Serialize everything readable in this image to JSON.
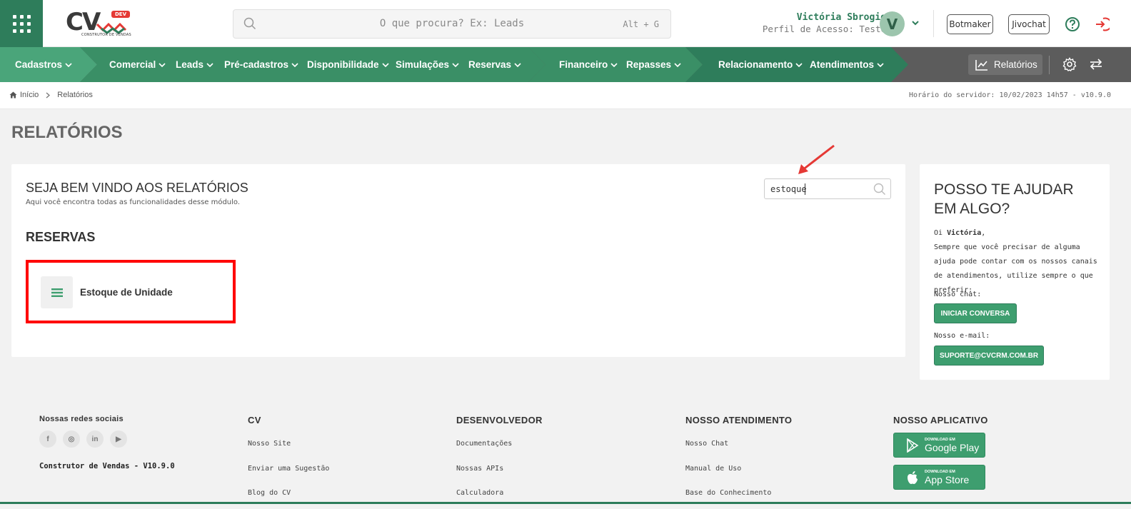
{
  "header": {
    "logo_text": "CV",
    "logo_badge": "DEV",
    "logo_sub": "CONSTRUTOR DE VENDAS",
    "search_placeholder": "O que procura? Ex: Leads",
    "search_shortcut": "Alt + G",
    "user_name": "Victória Sbrogio",
    "user_role": "Perfil de Acesso: Teste",
    "avatar_letter": "V",
    "buttons": [
      "Botmaker",
      "Jivochat"
    ]
  },
  "nav": {
    "items": [
      "Cadastros",
      "Comercial",
      "Leads",
      "Pré-cadastros",
      "Disponibilidade",
      "Simulações",
      "Reservas",
      "Financeiro",
      "Repasses",
      "Relacionamento",
      "Atendimentos"
    ],
    "reports_label": "Relatórios",
    "colors": {
      "dark_green": "#2e7d5b",
      "mid_green": "#3a8f66",
      "light_green": "#4aa57a",
      "gray": "#5c5c5c"
    }
  },
  "breadcrumb": {
    "home": "Início",
    "current": "Relatórios",
    "server_time": "Horário do servidor: 10/02/2023 14h57 - v10.9.0"
  },
  "page": {
    "title": "RELATÓRIOS",
    "welcome_title": "SEJA BEM VINDO AOS RELATÓRIOS",
    "welcome_sub": "Aqui você encontra todas as funcionalidades desse módulo.",
    "search_value": "estoque",
    "section_title": "RESERVAS",
    "report_item": "Estoque de Unidade"
  },
  "help": {
    "title": "POSSO TE AJUDAR EM ALGO?",
    "greeting_prefix": "Oi ",
    "greeting_name": "Victória",
    "greeting_suffix": ",",
    "body": "Sempre que você precisar de alguma ajuda pode contar com os nossos canais de atendimentos, utilize sempre o que preferir:",
    "chat_label": "Nosso chat:",
    "chat_button": "INICIAR CONVERSA",
    "email_label": "Nosso e-mail:",
    "email_button": "SUPORTE@CVCRM.COM.BR"
  },
  "footer": {
    "social_title": "Nossas redes sociais",
    "social_icons": [
      "f",
      "◎",
      "in",
      "▶"
    ],
    "version": "Construtor de Vendas - V10.9.0",
    "col_cv": {
      "title": "CV",
      "links": [
        "Nosso Site",
        "Enviar uma Sugestão",
        "Blog do CV"
      ]
    },
    "col_dev": {
      "title": "DESENVOLVEDOR",
      "links": [
        "Documentações",
        "Nossas APIs",
        "Calculadora"
      ]
    },
    "col_support": {
      "title": "NOSSO ATENDIMENTO",
      "links": [
        "Nosso Chat",
        "Manual de Uso",
        "Base do Conhecimento"
      ]
    },
    "col_app": {
      "title": "NOSSO APLICATIVO",
      "google_small": "DOWNLOAD EM",
      "google_big": "Google Play",
      "apple_small": "DOWNLOAD EM",
      "apple_big": "App Store"
    }
  }
}
